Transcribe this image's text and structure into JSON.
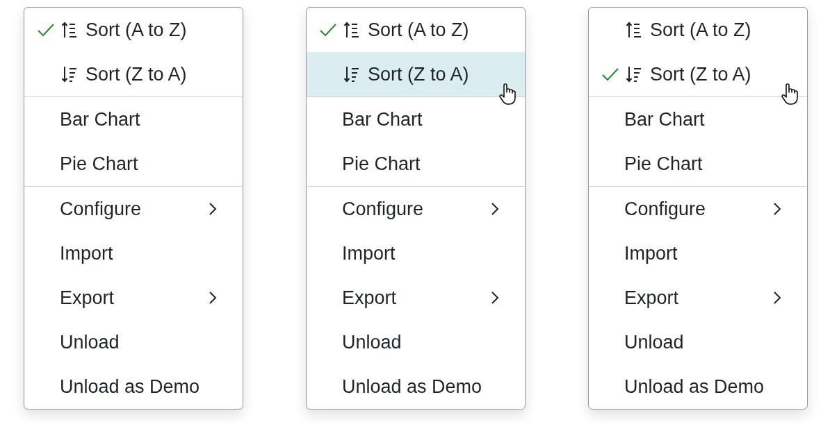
{
  "menus": [
    {
      "items": [
        {
          "kind": "sort-asc",
          "label": "Sort (A to Z)",
          "checked": true,
          "highlighted": false,
          "pointer": false,
          "divider_before": false,
          "submenu": false
        },
        {
          "kind": "sort-desc",
          "label": "Sort (Z to A)",
          "checked": false,
          "highlighted": false,
          "pointer": false,
          "divider_before": false,
          "submenu": false
        },
        {
          "kind": "plain",
          "label": "Bar Chart",
          "highlighted": false,
          "pointer": false,
          "divider_before": true,
          "submenu": false
        },
        {
          "kind": "plain",
          "label": "Pie Chart",
          "highlighted": false,
          "pointer": false,
          "divider_before": false,
          "submenu": false
        },
        {
          "kind": "plain",
          "label": "Configure",
          "highlighted": false,
          "pointer": false,
          "divider_before": true,
          "submenu": true
        },
        {
          "kind": "plain",
          "label": "Import",
          "highlighted": false,
          "pointer": false,
          "divider_before": false,
          "submenu": false
        },
        {
          "kind": "plain",
          "label": "Export",
          "highlighted": false,
          "pointer": false,
          "divider_before": false,
          "submenu": true
        },
        {
          "kind": "plain",
          "label": "Unload",
          "highlighted": false,
          "pointer": false,
          "divider_before": false,
          "submenu": false
        },
        {
          "kind": "plain",
          "label": "Unload as Demo",
          "highlighted": false,
          "pointer": false,
          "divider_before": false,
          "submenu": false
        }
      ]
    },
    {
      "items": [
        {
          "kind": "sort-asc",
          "label": "Sort (A to Z)",
          "checked": true,
          "highlighted": false,
          "pointer": false,
          "divider_before": false,
          "submenu": false
        },
        {
          "kind": "sort-desc",
          "label": "Sort (Z to A)",
          "checked": false,
          "highlighted": true,
          "pointer": true,
          "divider_before": false,
          "submenu": false
        },
        {
          "kind": "plain",
          "label": "Bar Chart",
          "highlighted": false,
          "pointer": false,
          "divider_before": true,
          "submenu": false
        },
        {
          "kind": "plain",
          "label": "Pie Chart",
          "highlighted": false,
          "pointer": false,
          "divider_before": false,
          "submenu": false
        },
        {
          "kind": "plain",
          "label": "Configure",
          "highlighted": false,
          "pointer": false,
          "divider_before": true,
          "submenu": true
        },
        {
          "kind": "plain",
          "label": "Import",
          "highlighted": false,
          "pointer": false,
          "divider_before": false,
          "submenu": false
        },
        {
          "kind": "plain",
          "label": "Export",
          "highlighted": false,
          "pointer": false,
          "divider_before": false,
          "submenu": true
        },
        {
          "kind": "plain",
          "label": "Unload",
          "highlighted": false,
          "pointer": false,
          "divider_before": false,
          "submenu": false
        },
        {
          "kind": "plain",
          "label": "Unload as Demo",
          "highlighted": false,
          "pointer": false,
          "divider_before": false,
          "submenu": false
        }
      ]
    },
    {
      "items": [
        {
          "kind": "sort-asc",
          "label": "Sort (A to Z)",
          "checked": false,
          "highlighted": false,
          "pointer": false,
          "divider_before": false,
          "submenu": false
        },
        {
          "kind": "sort-desc",
          "label": "Sort (Z to A)",
          "checked": true,
          "highlighted": false,
          "pointer": true,
          "divider_before": false,
          "submenu": false
        },
        {
          "kind": "plain",
          "label": "Bar Chart",
          "highlighted": false,
          "pointer": false,
          "divider_before": true,
          "submenu": false
        },
        {
          "kind": "plain",
          "label": "Pie Chart",
          "highlighted": false,
          "pointer": false,
          "divider_before": false,
          "submenu": false
        },
        {
          "kind": "plain",
          "label": "Configure",
          "highlighted": false,
          "pointer": false,
          "divider_before": true,
          "submenu": true
        },
        {
          "kind": "plain",
          "label": "Import",
          "highlighted": false,
          "pointer": false,
          "divider_before": false,
          "submenu": false
        },
        {
          "kind": "plain",
          "label": "Export",
          "highlighted": false,
          "pointer": false,
          "divider_before": false,
          "submenu": true
        },
        {
          "kind": "plain",
          "label": "Unload",
          "highlighted": false,
          "pointer": false,
          "divider_before": false,
          "submenu": false
        },
        {
          "kind": "plain",
          "label": "Unload as Demo",
          "highlighted": false,
          "pointer": false,
          "divider_before": false,
          "submenu": false
        }
      ]
    }
  ]
}
